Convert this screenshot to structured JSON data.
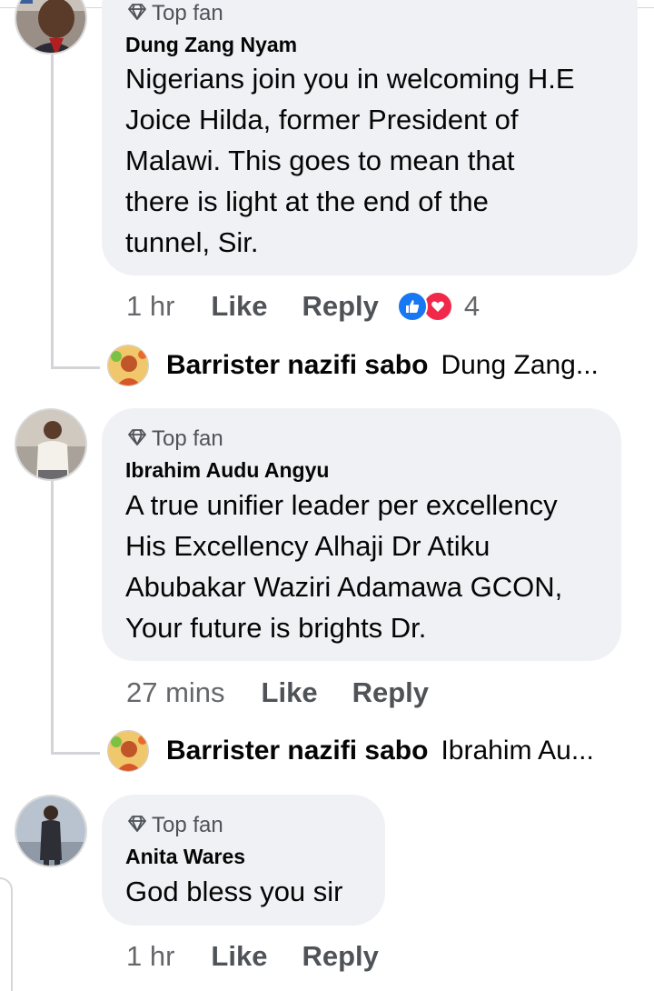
{
  "comments": [
    {
      "badge": "Top fan",
      "author": "Dung Zang Nyam",
      "text": "Nigerians join you in welcoming H.E\nJoice Hilda, former President of\nMalawi. This goes to mean that\nthere is light at the end of the\ntunnel, Sir.",
      "time": "1 hr",
      "like_label": "Like",
      "reply_label": "Reply",
      "reaction_count": "4",
      "reactions": [
        "like-icon",
        "love-icon"
      ],
      "reply_preview": {
        "author": "Barrister nazifi sabo",
        "text": "Dung Zang..."
      }
    },
    {
      "badge": "Top fan",
      "author": "Ibrahim Audu Angyu",
      "text": "A true unifier leader per excellency\nHis Excellency Alhaji Dr Atiku\nAbubakar Waziri Adamawa GCON,\nYour future is brights Dr.",
      "time": "27 mins",
      "like_label": "Like",
      "reply_label": "Reply",
      "reply_preview": {
        "author": "Barrister nazifi sabo",
        "text": "Ibrahim Au..."
      }
    },
    {
      "badge": "Top fan",
      "author": "Anita Wares",
      "text": "God bless you sir",
      "time": "1 hr",
      "like_label": "Like",
      "reply_label": "Reply"
    }
  ],
  "colors": {
    "bubble": "#eff1f4",
    "secondary_text": "#65676b",
    "like_blue": "#1877f2",
    "love_red": "#f02849"
  }
}
